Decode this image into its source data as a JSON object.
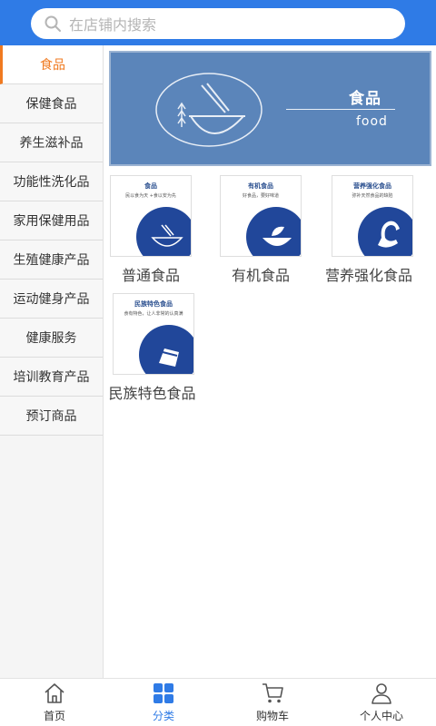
{
  "search": {
    "placeholder": "在店铺内搜索",
    "icon": "search-icon"
  },
  "sidebar": {
    "items": [
      {
        "label": "食品",
        "active": true
      },
      {
        "label": "保健食品"
      },
      {
        "label": "养生滋补品"
      },
      {
        "label": "功能性洗化品"
      },
      {
        "label": "家用保健用品"
      },
      {
        "label": "生殖健康产品"
      },
      {
        "label": "运动健身产品"
      },
      {
        "label": "健康服务"
      },
      {
        "label": "培训教育产品"
      },
      {
        "label": "预订商品"
      }
    ]
  },
  "banner": {
    "title": "食品",
    "subtitle": "food"
  },
  "products": [
    {
      "label": "普通食品",
      "thumb_title": "食品",
      "thumb_desc": "民以食为天 +食以安为先"
    },
    {
      "label": "有机食品",
      "thumb_title": "有机食品",
      "thumb_desc": "好食品，要好味道"
    },
    {
      "label": "营养强化食品",
      "thumb_title": "营养强化食品",
      "thumb_desc": "弥补天然食品的缺陷"
    },
    {
      "label": "民族特色食品",
      "thumb_title": "民族特色食品",
      "thumb_desc": "食有特色，让人非常的认真满"
    }
  ],
  "tabbar": {
    "items": [
      {
        "label": "首页",
        "icon": "home-icon"
      },
      {
        "label": "分类",
        "icon": "category-grid-icon",
        "active": true
      },
      {
        "label": "购物车",
        "icon": "cart-icon"
      },
      {
        "label": "个人中心",
        "icon": "user-icon"
      }
    ]
  },
  "colors": {
    "primary": "#2f7be6",
    "active_sidebar": "#f07a20",
    "banner_bg": "#5b85ba",
    "thumb_accent": "#21479a"
  }
}
